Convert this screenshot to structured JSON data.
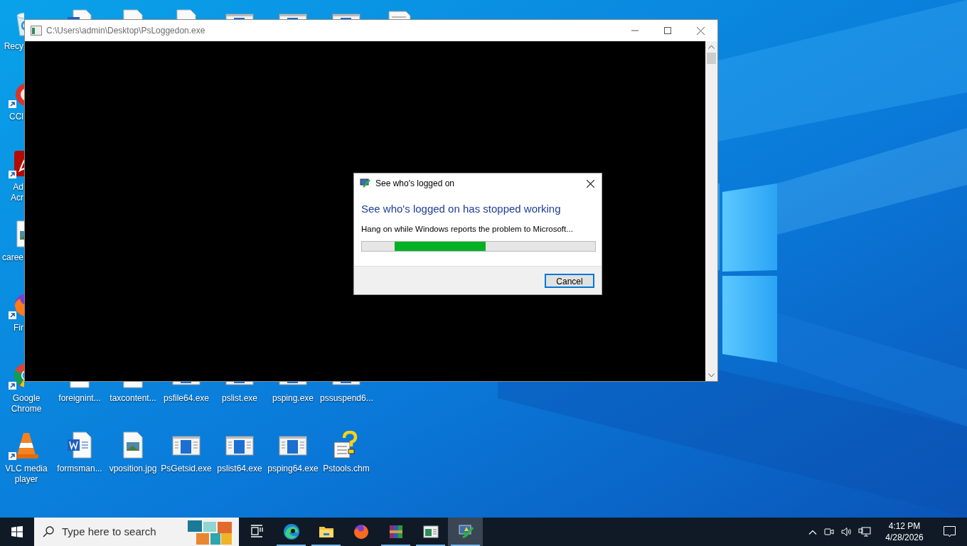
{
  "desktop": {
    "icon_rows": [
      [
        {
          "label": "Recy",
          "kind": "recycle-bin",
          "shortcut": false
        },
        {
          "kind": "word-doc",
          "shortcut": false
        },
        {
          "kind": "image-file",
          "shortcut": false
        },
        {
          "kind": "image-file",
          "shortcut": false
        },
        {
          "kind": "exe",
          "shortcut": false
        },
        {
          "kind": "exe",
          "shortcut": false
        },
        {
          "kind": "exe",
          "shortcut": false
        },
        {
          "kind": "text-file",
          "shortcut": false
        }
      ],
      [
        {
          "label": "CCl",
          "kind": "ccleaner",
          "shortcut": true
        }
      ],
      [
        {
          "label": "Ad Acr",
          "kind": "acrobat",
          "shortcut": true
        }
      ],
      [
        {
          "label": "caree",
          "kind": "image-file",
          "shortcut": false
        }
      ],
      [
        {
          "label": "Fir",
          "kind": "firefox",
          "shortcut": true
        }
      ],
      [
        {
          "label": "Google Chrome",
          "kind": "chrome",
          "shortcut": true
        },
        {
          "label": "foreignint...",
          "kind": "blank-file",
          "shortcut": false
        },
        {
          "label": "taxcontent...",
          "kind": "blank-file",
          "shortcut": false
        },
        {
          "label": "psfile64.exe",
          "kind": "exe",
          "shortcut": false
        },
        {
          "label": "pslist.exe",
          "kind": "exe",
          "shortcut": false
        },
        {
          "label": "psping.exe",
          "kind": "exe",
          "shortcut": false
        },
        {
          "label": "pssuspend6...",
          "kind": "exe",
          "shortcut": false
        }
      ],
      [
        {
          "label": "VLC media player",
          "kind": "vlc",
          "shortcut": true
        },
        {
          "label": "formsman...",
          "kind": "word-doc",
          "shortcut": false
        },
        {
          "label": "vposition.jpg",
          "kind": "image-file",
          "shortcut": false
        },
        {
          "label": "PsGetsid.exe",
          "kind": "exe",
          "shortcut": false
        },
        {
          "label": "pslist64.exe",
          "kind": "exe",
          "shortcut": false
        },
        {
          "label": "psping64.exe",
          "kind": "exe",
          "shortcut": false
        },
        {
          "label": "Pstools.chm",
          "kind": "help-file",
          "shortcut": false
        }
      ]
    ]
  },
  "window": {
    "title": "C:\\Users\\admin\\Desktop\\PsLoggedon.exe"
  },
  "dialog": {
    "title": "See who's logged on",
    "heading": "See who's logged on has stopped working",
    "message": "Hang on while Windows reports the problem to Microsoft...",
    "progress": {
      "kind": "marquee",
      "level": 0.39
    },
    "buttons": [
      {
        "label": "Cancel",
        "default": true
      }
    ]
  },
  "taskbar": {
    "search": {
      "placeholder": "Type here to search"
    },
    "apps": [
      {
        "kind": "task-view",
        "running": false,
        "selected": false
      },
      {
        "kind": "edge",
        "running": true,
        "selected": false
      },
      {
        "kind": "explorer",
        "running": true,
        "selected": false
      },
      {
        "kind": "firefox",
        "running": false,
        "selected": false
      },
      {
        "kind": "winrar",
        "running": true,
        "selected": false
      },
      {
        "kind": "app-window",
        "running": true,
        "selected": false
      },
      {
        "kind": "error-app",
        "running": true,
        "selected": true
      }
    ],
    "clock": {
      "time": "4:12 PM",
      "date": "4/28/2026"
    }
  }
}
